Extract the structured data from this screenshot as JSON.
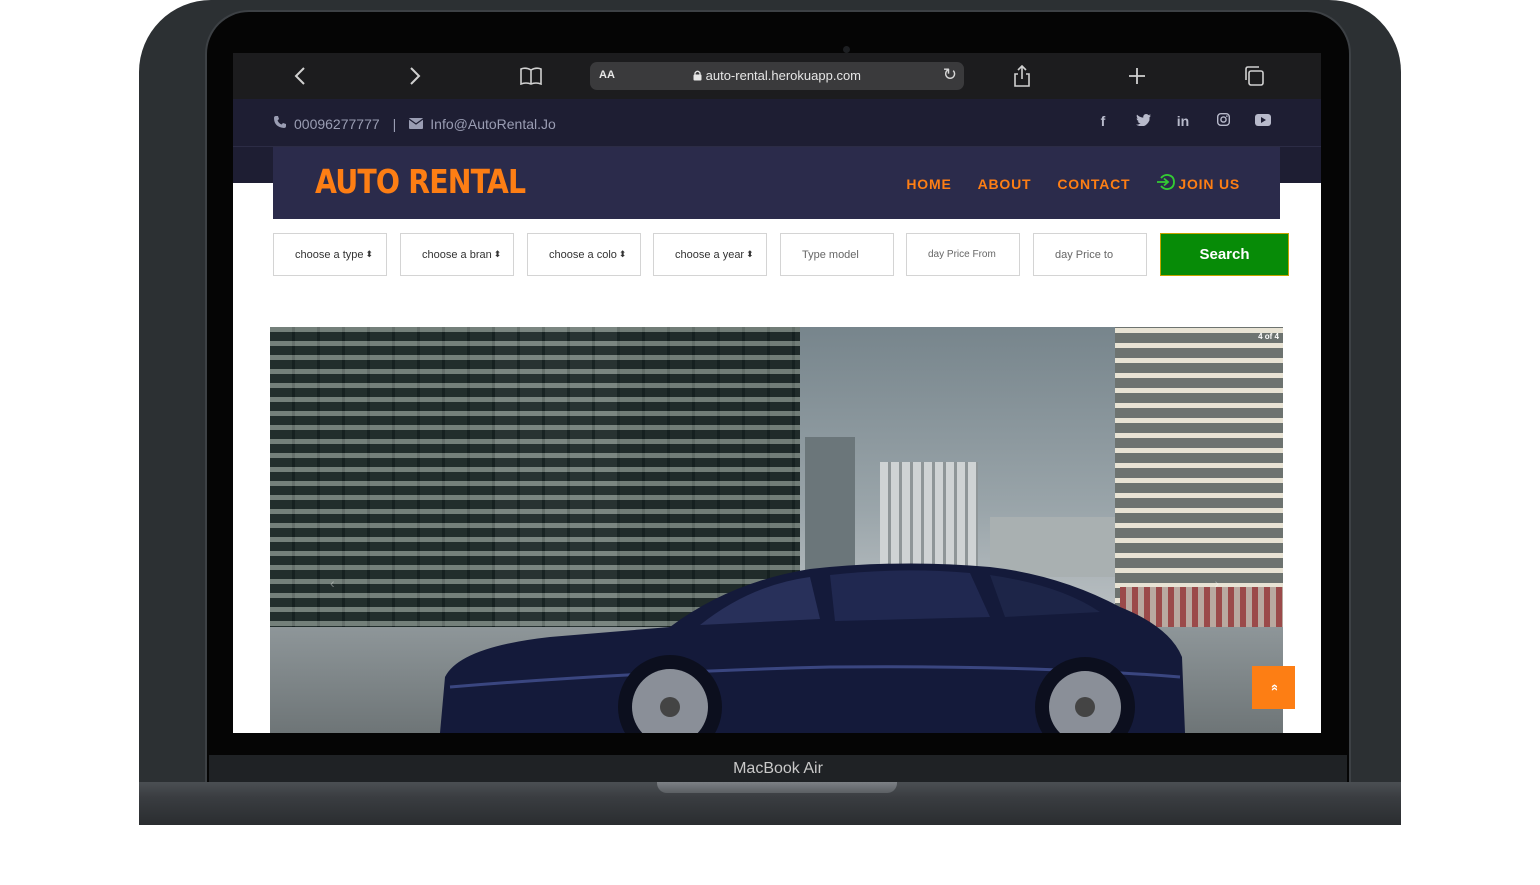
{
  "device": {
    "label": "MacBook Air"
  },
  "browser": {
    "reader_label": "AA",
    "url": "auto-rental.herokuapp.com",
    "icons": [
      "back-icon",
      "forward-icon",
      "bookmarks-icon",
      "lock-icon",
      "reload-icon",
      "share-icon",
      "new-tab-icon",
      "tabs-icon"
    ]
  },
  "topbar": {
    "phone": "00096277777",
    "separator": "|",
    "email": "Info@AutoRental.Jo",
    "socials": [
      {
        "name": "facebook-icon",
        "glyph": "f"
      },
      {
        "name": "twitter-icon",
        "glyph": "🐦"
      },
      {
        "name": "linkedin-icon",
        "glyph": "in"
      },
      {
        "name": "instagram-icon",
        "glyph": "◎"
      },
      {
        "name": "youtube-icon",
        "glyph": "▶"
      }
    ]
  },
  "nav": {
    "brand": "AUTO RENTAL",
    "links": {
      "home": "HOME",
      "about": "ABOUT",
      "contact": "CONTACT",
      "join": "JOIN US"
    }
  },
  "filters": {
    "type": "choose a type",
    "brand": "choose a bran",
    "color": "choose a colo",
    "year": "choose a year",
    "model_placeholder": "Type model",
    "price_from_placeholder": "day Price From",
    "price_to_placeholder": "day Price to",
    "search_label": "Search"
  },
  "hero": {
    "slide_counter": "4 of 4",
    "prev": "‹",
    "next": "›"
  },
  "scroll_top": {
    "label": "»"
  },
  "colors": {
    "accent": "#fd7e14",
    "nav_bg": "#2b2b4b",
    "topbar_bg": "#1e1e33",
    "search_bg": "#078b07"
  }
}
